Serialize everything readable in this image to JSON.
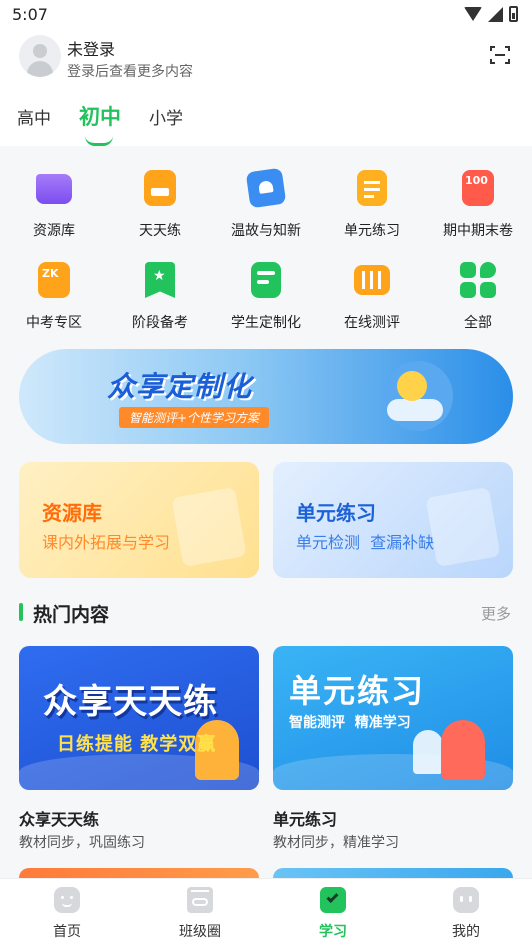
{
  "status": {
    "time": "5:07"
  },
  "header": {
    "user_name": "未登录",
    "user_hint": "登录后查看更多内容",
    "tabs": [
      {
        "label": "高中"
      },
      {
        "label": "初中",
        "active": true
      },
      {
        "label": "小学"
      }
    ]
  },
  "grid": [
    {
      "label": "资源库",
      "icon": "folder-icon",
      "color": "#8b5cf6"
    },
    {
      "label": "天天练",
      "icon": "calendar-practice-icon",
      "color": "#ffa31a"
    },
    {
      "label": "温故与知新",
      "icon": "heart-book-icon",
      "color": "#3b8df2"
    },
    {
      "label": "单元练习",
      "icon": "clipboard-icon",
      "color": "#ffb020"
    },
    {
      "label": "期中期末卷",
      "icon": "exam-100-icon",
      "color": "#ff5a4a"
    },
    {
      "label": "中考专区",
      "icon": "zk-icon",
      "color": "#ffa31a"
    },
    {
      "label": "阶段备考",
      "icon": "star-bookmark-icon",
      "color": "#22c35d"
    },
    {
      "label": "学生定制化",
      "icon": "student-custom-icon",
      "color": "#22c35d"
    },
    {
      "label": "在线测评",
      "icon": "test-sliders-icon",
      "color": "#ffa31a"
    },
    {
      "label": "全部",
      "icon": "all-apps-icon",
      "color": "#22c35d"
    }
  ],
  "banner": {
    "title": "众享定制化",
    "subtitle": "智能测评+个性学习方案"
  },
  "feature_cards": [
    {
      "title": "资源库",
      "subtitle": "课内外拓展与学习"
    },
    {
      "title": "单元练习",
      "subtitle": "单元检测  查漏补缺"
    }
  ],
  "hot": {
    "title": "热门内容",
    "more": "更多",
    "items": [
      {
        "cover_big": "众享天天练",
        "cover_small": "日练提能 教学双赢",
        "title": "众享天天练",
        "subtitle": "教材同步，巩固练习"
      },
      {
        "cover_big": "单元练习",
        "cover_small": "智能测评  精准学习",
        "title": "单元练习",
        "subtitle": "教材同步，精准学习"
      }
    ]
  },
  "nav": [
    {
      "label": "首页",
      "icon": "home-face-icon"
    },
    {
      "label": "班级圈",
      "icon": "class-circle-icon"
    },
    {
      "label": "学习",
      "icon": "study-check-icon",
      "active": true
    },
    {
      "label": "我的",
      "icon": "profile-face-icon"
    }
  ],
  "colors": {
    "accent": "#22c35d",
    "orange": "#ff6d0a",
    "blue": "#1b62d6"
  }
}
